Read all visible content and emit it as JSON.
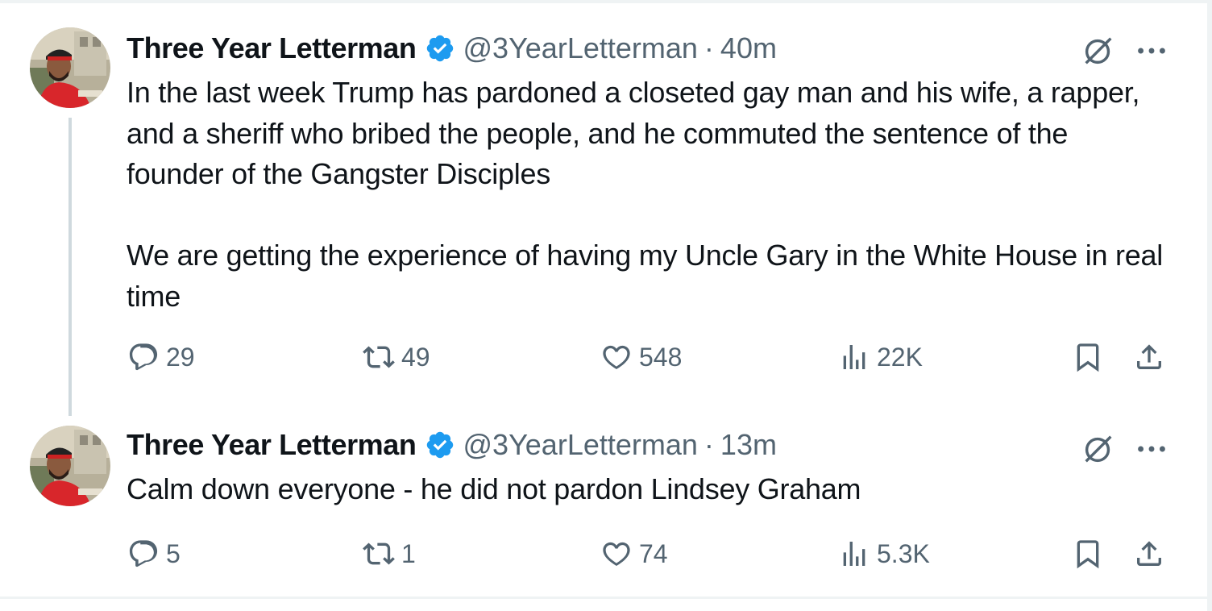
{
  "colors": {
    "text": "#0f1419",
    "secondary": "#536471",
    "verified": "#1d9bf0",
    "divider": "#eff3f4",
    "thread_line": "#cfd9de"
  },
  "tweets": [
    {
      "author": {
        "name": "Three Year Letterman",
        "handle": "@3YearLetterman",
        "verified_icon": "verified-badge-icon"
      },
      "separator": "·",
      "time": "40m",
      "text_paragraphs": [
        "In the last week Trump has pardoned a closeted gay man and his wife, a rapper, and a sheriff who bribed the people, and he commuted the sentence of the founder of the Gangster Disciples",
        "We are getting the experience of having my Uncle Gary in the White House in real time"
      ],
      "stats": {
        "replies": "29",
        "reposts": "49",
        "likes": "548",
        "views": "22K"
      }
    },
    {
      "author": {
        "name": "Three Year Letterman",
        "handle": "@3YearLetterman",
        "verified_icon": "verified-badge-icon"
      },
      "separator": "·",
      "time": "13m",
      "text_paragraphs": [
        "Calm down everyone - he did not pardon Lindsey Graham"
      ],
      "stats": {
        "replies": "5",
        "reposts": "1",
        "likes": "74",
        "views": "5.3K"
      }
    }
  ]
}
